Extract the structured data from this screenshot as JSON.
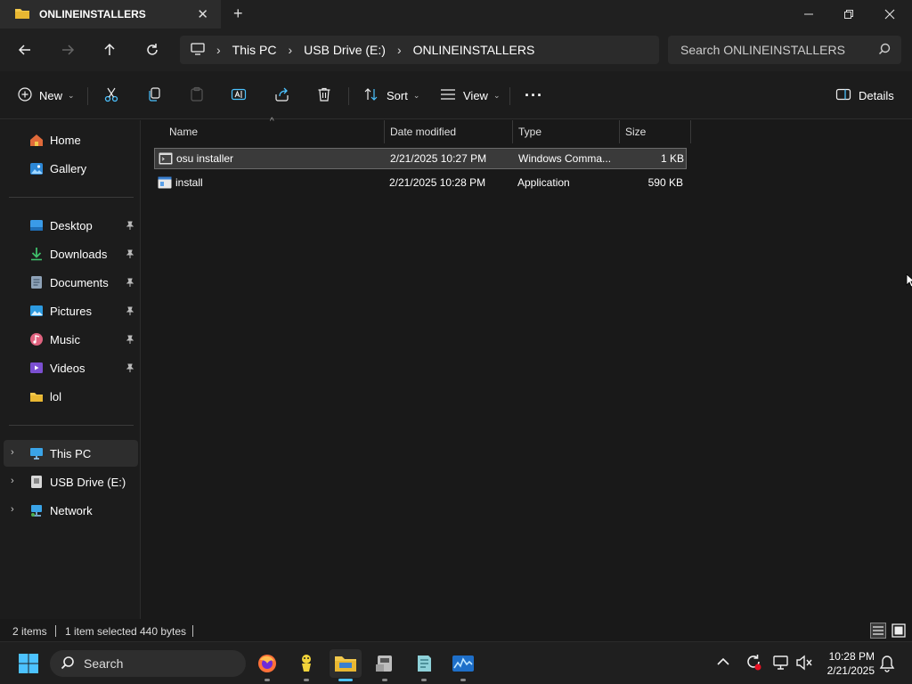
{
  "window": {
    "tab_title": "ONLINEINSTALLERS",
    "new_tab": "+",
    "close": "✕"
  },
  "address": {
    "crumbs": [
      "This PC",
      "USB Drive (E:)",
      "ONLINEINSTALLERS"
    ]
  },
  "search": {
    "placeholder": "Search ONLINEINSTALLERS"
  },
  "commands": {
    "new_label": "New",
    "sort_label": "Sort",
    "view_label": "View",
    "more_label": "···",
    "details_label": "Details"
  },
  "sidebar": {
    "items": [
      {
        "label": "Home"
      },
      {
        "label": "Gallery"
      },
      {
        "label": "Desktop"
      },
      {
        "label": "Downloads"
      },
      {
        "label": "Documents"
      },
      {
        "label": "Pictures"
      },
      {
        "label": "Music"
      },
      {
        "label": "Videos"
      },
      {
        "label": "lol"
      },
      {
        "label": "This PC"
      },
      {
        "label": "USB Drive (E:)"
      },
      {
        "label": "Network"
      }
    ]
  },
  "columns": {
    "name": "Name",
    "date": "Date modified",
    "type": "Type",
    "size": "Size"
  },
  "files": [
    {
      "name": "osu installer",
      "date": "2/21/2025 10:27 PM",
      "type": "Windows Comma...",
      "size": "1 KB",
      "selected": true
    },
    {
      "name": "install",
      "date": "2/21/2025 10:28 PM",
      "type": "Application",
      "size": "590 KB",
      "selected": false
    }
  ],
  "status": {
    "items": "2 items",
    "selected": "1 item selected",
    "bytes": "440 bytes"
  },
  "taskbar": {
    "search": "Search",
    "time": "10:28 PM",
    "date": "2/21/2025"
  },
  "colors": {
    "accent": "#4cc2ff",
    "folder": "#f2c84b"
  }
}
